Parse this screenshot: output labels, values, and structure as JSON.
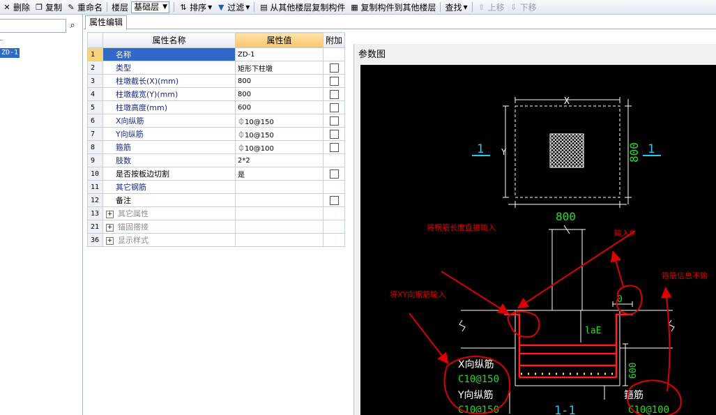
{
  "toolbar": {
    "delete": "删除",
    "copy": "复制",
    "rename": "重命名",
    "floor_label": "楼层",
    "floor_value": "基础层",
    "sort": "排序",
    "filter": "过滤",
    "copy_from_floor": "从其他楼层复制构件",
    "copy_to_floor": "复制构件到其他楼层",
    "find": "查找",
    "move_up": "上移",
    "move_down": "下移"
  },
  "tree": {
    "selected_item": "ZD-1"
  },
  "tab": {
    "label": "属性编辑"
  },
  "grid": {
    "headers": {
      "num": "",
      "name": "属性名称",
      "value": "属性值",
      "extra": "附加"
    },
    "rows": [
      {
        "num": "1",
        "name": "名称",
        "value": "ZD-1",
        "checkbox": false,
        "selected": true,
        "style": "blue"
      },
      {
        "num": "2",
        "name": "类型",
        "value": "矩形下柱墩",
        "checkbox": true,
        "style": "blue"
      },
      {
        "num": "3",
        "name": "柱墩截长(X)(mm)",
        "value": "800",
        "checkbox": true,
        "style": "blue"
      },
      {
        "num": "4",
        "name": "柱墩截宽(Y)(mm)",
        "value": "800",
        "checkbox": true,
        "style": "blue"
      },
      {
        "num": "5",
        "name": "柱墩高度(mm)",
        "value": "600",
        "checkbox": true,
        "style": "blue"
      },
      {
        "num": "6",
        "name": "X向纵筋",
        "value": "⏀10@150",
        "checkbox": true,
        "style": "blue"
      },
      {
        "num": "7",
        "name": "Y向纵筋",
        "value": "⏀10@150",
        "checkbox": true,
        "style": "blue"
      },
      {
        "num": "8",
        "name": "箍筋",
        "value": "⏀10@100",
        "checkbox": true,
        "style": "blue"
      },
      {
        "num": "9",
        "name": "肢数",
        "value": "2*2",
        "checkbox": false,
        "style": "blue"
      },
      {
        "num": "10",
        "name": "是否按板边切割",
        "value": "是",
        "checkbox": true,
        "style": "plain"
      },
      {
        "num": "11",
        "name": "其它钢筋",
        "value": "",
        "checkbox": false,
        "style": "blue"
      },
      {
        "num": "12",
        "name": "备注",
        "value": "",
        "checkbox": true,
        "style": "plain"
      },
      {
        "num": "13",
        "name": "其它属性",
        "value": "",
        "checkbox": false,
        "style": "group"
      },
      {
        "num": "21",
        "name": "锚固搭接",
        "value": "",
        "checkbox": false,
        "style": "group"
      },
      {
        "num": "36",
        "name": "显示样式",
        "value": "",
        "checkbox": false,
        "style": "group"
      }
    ]
  },
  "param": {
    "title": "参数图",
    "plan": {
      "dim_x_label": "X",
      "dim_y_label": "Y",
      "dim_bottom": "800",
      "dim_right": "800",
      "section_mark_left": "1",
      "section_mark_right": "1"
    },
    "section": {
      "lae": "laE",
      "zero": "0",
      "height": "600",
      "x_bar_label": "X向纵筋",
      "x_bar_value": "C10@150",
      "y_bar_label": "Y向纵筋",
      "y_bar_value": "C10@150",
      "stirrup_label": "箍筋",
      "stirrup_value": "C10@100",
      "section_title": "1-1"
    },
    "annotations": {
      "direct_input": "将钢筋长度直接输入",
      "input_zero": "输入0",
      "stirrup_no_input": "箍筋信息不输",
      "xy_input": "将XY向钢筋输入"
    }
  },
  "colors": {
    "cad_white": "#ffffff",
    "cad_green": "#22dd22",
    "cad_cyan": "#22ccee",
    "cad_red": "#ff2020",
    "cad_yellow": "#ffee00",
    "annot_red": "#dd0000"
  }
}
